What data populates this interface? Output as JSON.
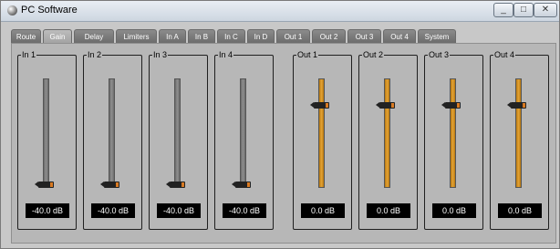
{
  "window": {
    "title": "PC Software",
    "min_label": "_",
    "max_label": "□",
    "close_label": "✕"
  },
  "tabs": [
    {
      "label": "Route"
    },
    {
      "label": "Gain",
      "active": true
    },
    {
      "label": "Delay"
    },
    {
      "label": "Limiters"
    },
    {
      "label": "In A"
    },
    {
      "label": "In B"
    },
    {
      "label": "In C"
    },
    {
      "label": "In D"
    },
    {
      "label": "Out 1"
    },
    {
      "label": "Out 2"
    },
    {
      "label": "Out 3"
    },
    {
      "label": "Out 4"
    },
    {
      "label": "System"
    }
  ],
  "inputs": [
    {
      "label": "In 1",
      "value": "-40.0 dB",
      "level": 0
    },
    {
      "label": "In 2",
      "value": "-40.0 dB",
      "level": 0
    },
    {
      "label": "In 3",
      "value": "-40.0 dB",
      "level": 0
    },
    {
      "label": "In 4",
      "value": "-40.0 dB",
      "level": 0
    }
  ],
  "outputs": [
    {
      "label": "Out 1",
      "value": "0.0 dB",
      "level": 0.77
    },
    {
      "label": "Out 2",
      "value": "0.0 dB",
      "level": 0.77
    },
    {
      "label": "Out 3",
      "value": "0.0 dB",
      "level": 0.77
    },
    {
      "label": "Out 4",
      "value": "0.0 dB",
      "level": 0.77
    }
  ],
  "colors": {
    "input_track": "#8f8f8f",
    "output_track": "#e4a436",
    "knob_accent": "#d97a22"
  }
}
